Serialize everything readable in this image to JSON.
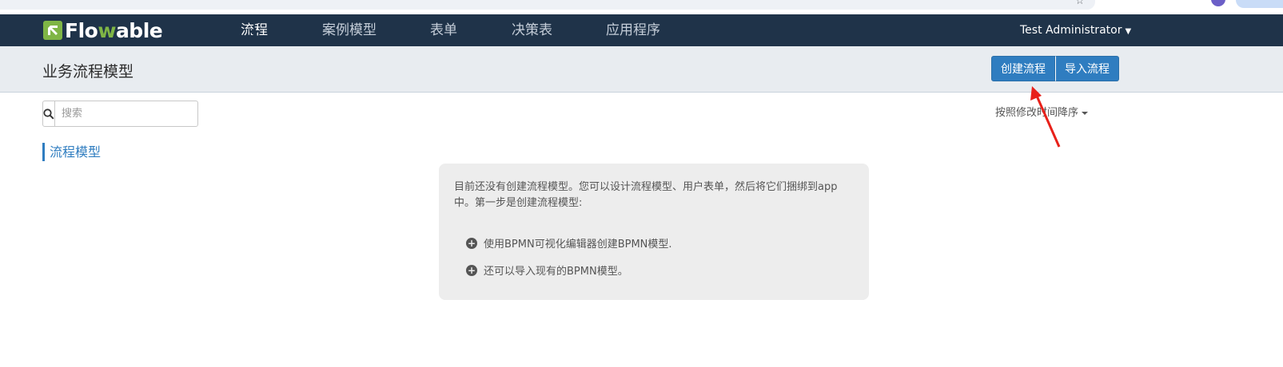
{
  "app": {
    "logo_text_start": "Flo",
    "logo_text_w": "w",
    "logo_text_end": "able"
  },
  "nav": {
    "items": [
      {
        "label": "流程",
        "active": true
      },
      {
        "label": "案例模型",
        "active": false
      },
      {
        "label": "表单",
        "active": false
      },
      {
        "label": "决策表",
        "active": false
      },
      {
        "label": "应用程序",
        "active": false
      }
    ],
    "user": "Test Administrator"
  },
  "header": {
    "title": "业务流程模型",
    "create_button": "创建流程",
    "import_button": "导入流程"
  },
  "sidebar": {
    "search_placeholder": "搜索",
    "search_icon": "search-icon",
    "section_title": "流程模型"
  },
  "sort": {
    "label": "按照修改时间降序"
  },
  "empty_state": {
    "intro": "目前还没有创建流程模型。您可以设计流程模型、用户表单，然后将它们捆绑到app中。第一步是创建流程模型:",
    "options": [
      "使用BPMN可视化编辑器创建BPMN模型.",
      "还可以导入现有的BPMN模型。"
    ]
  },
  "colors": {
    "navbar": "#1f3349",
    "brand_green": "#7fb545",
    "primary": "#2f7dc0",
    "annotation": "#e8211a"
  }
}
